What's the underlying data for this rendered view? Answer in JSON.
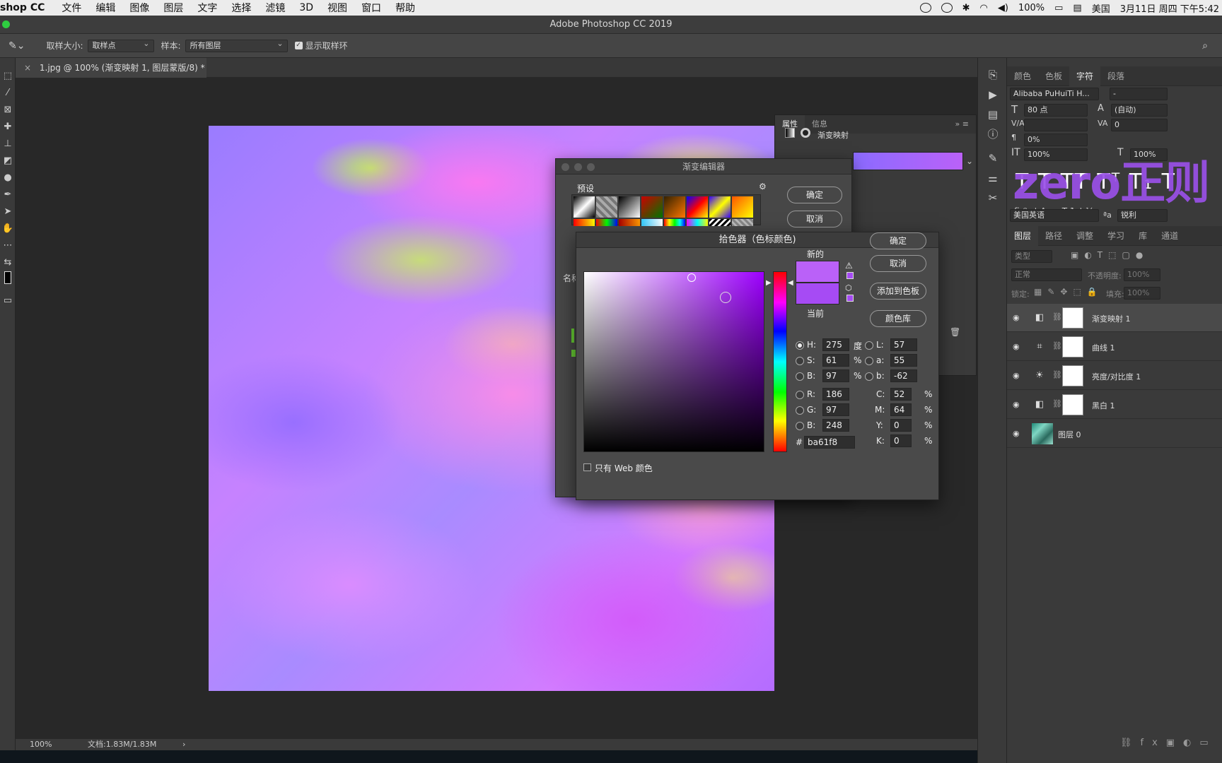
{
  "menubar": {
    "app": "shop CC",
    "items": [
      "文件",
      "编辑",
      "图像",
      "图层",
      "文字",
      "选择",
      "滤镜",
      "3D",
      "视图",
      "窗口",
      "帮助"
    ],
    "battery": "100%",
    "input_method": "美国",
    "datetime": "3月11日 周四 下午5:42"
  },
  "window": {
    "title": "Adobe Photoshop CC 2019"
  },
  "options": {
    "sample_size_label": "取样大小:",
    "sample_size_value": "取样点",
    "sample_label": "样本:",
    "sample_value": "所有图层",
    "show_ring_label": "显示取样环"
  },
  "document": {
    "tab_title": "1.jpg @ 100% (渐变映射 1, 图层蒙版/8) *",
    "zoom": "100%",
    "doc_size": "文档:1.83M/1.83M"
  },
  "properties": {
    "tabs": [
      "属性",
      "信息"
    ],
    "adjustment_name": "渐变映射"
  },
  "character": {
    "tabs": [
      "颜色",
      "色板",
      "字符",
      "段落"
    ],
    "font_family": "Alibaba PuHuiTi H...",
    "font_style": "-",
    "font_size": "80 点",
    "leading": "(自动)",
    "tracking": "0",
    "scale_pct": "0%",
    "vertical_scale": "100%",
    "horizontal_scale": "100%",
    "language": "美国英语",
    "antialias": "锐利",
    "watermark": "zero正则"
  },
  "layers_panel": {
    "tabs": [
      "图层",
      "路径",
      "调整",
      "学习",
      "库",
      "通道"
    ],
    "filter_placeholder": "类型",
    "blend_mode": "正常",
    "opacity_label": "不透明度:",
    "opacity_value": "100%",
    "lock_label": "锁定:",
    "fill_label": "填充:",
    "fill_value": "100%",
    "layers": [
      {
        "name": "渐变映射 1"
      },
      {
        "name": "曲线 1"
      },
      {
        "name": "亮度/对比度 1"
      },
      {
        "name": "黑白 1"
      },
      {
        "name": "图层 0"
      }
    ]
  },
  "gradient_editor": {
    "title": "渐变编辑器",
    "presets_label": "预设",
    "ok": "确定",
    "cancel": "取消",
    "name_label": "名称"
  },
  "color_picker": {
    "title": "拾色器（色标颜色)",
    "new_label": "新的",
    "current_label": "当前",
    "ok": "确定",
    "cancel": "取消",
    "add_to_swatches": "添加到色板",
    "color_libraries": "颜色库",
    "web_only_label": "只有 Web 颜色",
    "H": "275",
    "H_unit": "度",
    "S": "61",
    "S_unit": "%",
    "Bv": "97",
    "B_unit": "%",
    "R": "186",
    "G": "97",
    "Bc": "248",
    "L": "57",
    "a": "55",
    "b": "-62",
    "C": "52",
    "M": "64",
    "Y": "0",
    "K": "0",
    "pct": "%",
    "hex": "ba61f8",
    "new_color": "#ba61f8",
    "current_color": "#a64bf4"
  }
}
